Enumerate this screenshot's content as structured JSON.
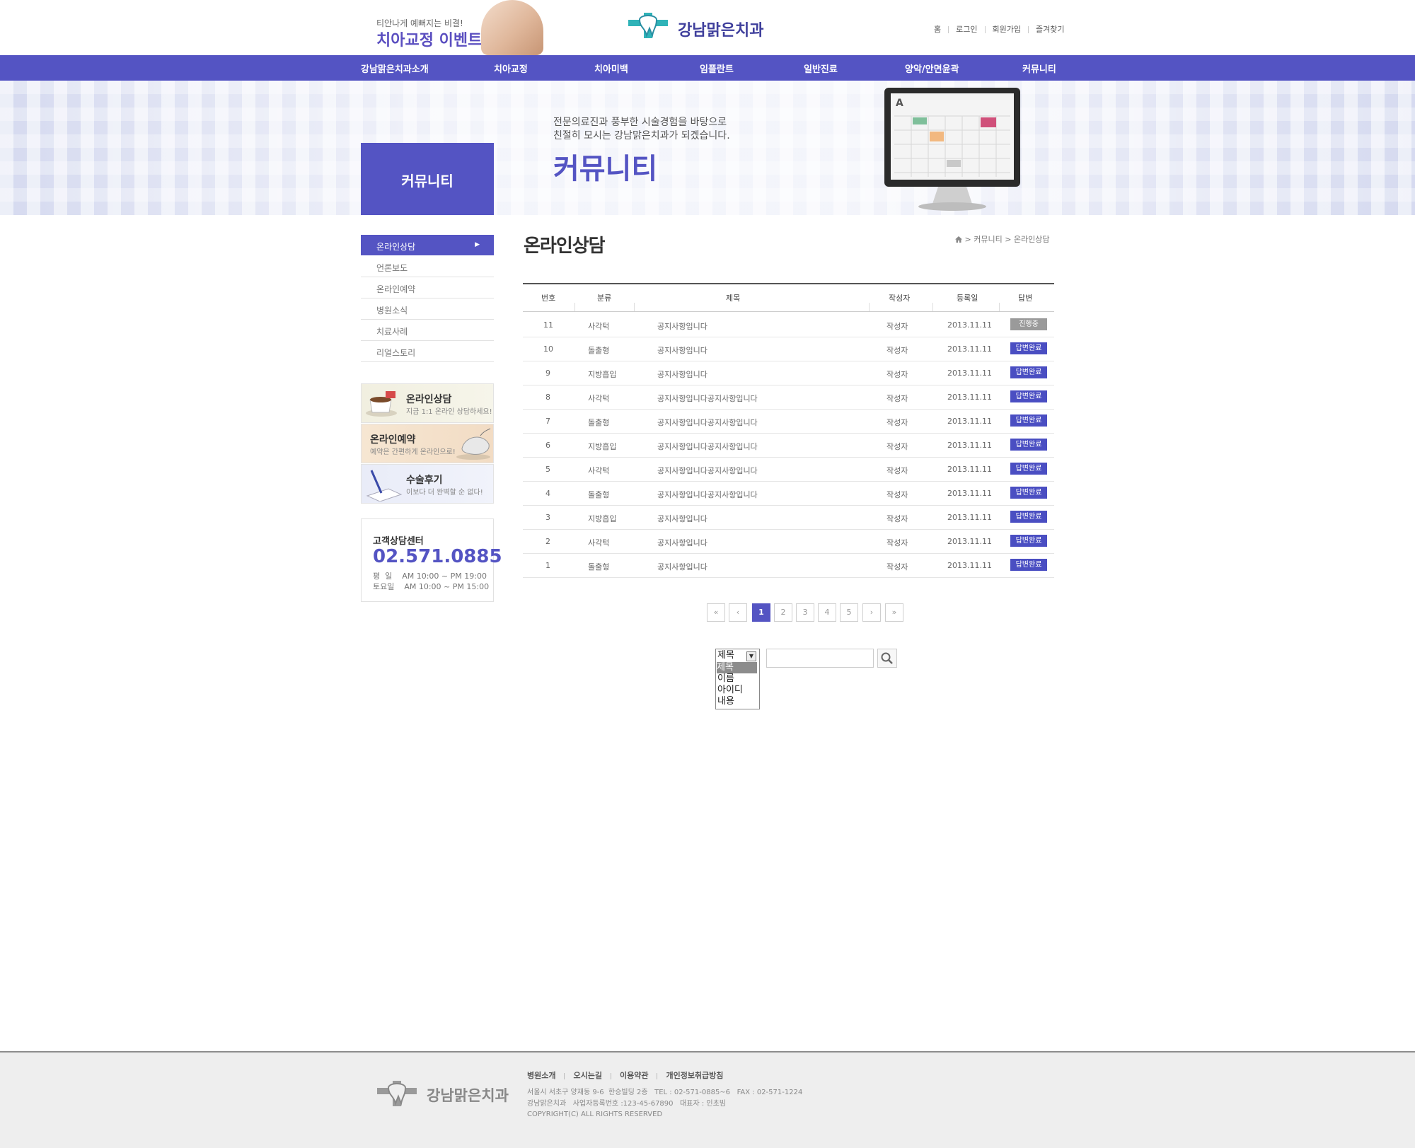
{
  "header": {
    "promo_sub": "티안나게 예뻐지는 비결!",
    "promo_title": "치아교정 이벤트",
    "logo_text": "강남맑은치과",
    "util_links": [
      "홈",
      "로그인",
      "회원가입",
      "즐겨찾기"
    ]
  },
  "gnb": [
    "강남맑은치과소개",
    "치아교정",
    "치아미백",
    "임플란트",
    "일반진료",
    "양악/안면윤곽",
    "커뮤니티"
  ],
  "banner": {
    "box_label": "커뮤니티",
    "line1": "전문의료진과 풍부한 시술경험을 바탕으로",
    "line2": "친절히 모시는 강남맑은치과가 되겠습니다.",
    "title": "커뮤니티"
  },
  "lnb": [
    "온라인상담",
    "언론보도",
    "온라인예약",
    "병원소식",
    "치료사례",
    "리얼스토리"
  ],
  "quick": [
    {
      "title": "온라인상담",
      "sub": "지금 1:1 온라인 상담하세요!"
    },
    {
      "title": "온라인예약",
      "sub": "예약은 간편하게 온라인으로!"
    },
    {
      "title": "수술후기",
      "sub": "이보다 더 완벽할 순 없다!"
    }
  ],
  "cs": {
    "title": "고객상담센터",
    "phone": "02.571.0885",
    "hours1": "평  일    AM 10:00 ~ PM 19:00",
    "hours2": "토요일    AM 10:00 ~ PM 15:00"
  },
  "content": {
    "page_title": "온라인상담",
    "breadcrumb": "> 커뮤니티 > 온라인상담"
  },
  "table": {
    "headers": [
      "번호",
      "분류",
      "제목",
      "작성자",
      "등록일",
      "답변"
    ],
    "rows": [
      {
        "no": "11",
        "cat": "사각턱",
        "title": "공지사항입니다",
        "writer": "작성자",
        "date": "2013.11.11",
        "status": "진행중",
        "state": "progress"
      },
      {
        "no": "10",
        "cat": "돌출형",
        "title": "공지사항입니다",
        "writer": "작성자",
        "date": "2013.11.11",
        "status": "답변완료",
        "state": "done"
      },
      {
        "no": "9",
        "cat": "지방흡입",
        "title": "공지사항입니다",
        "writer": "작성자",
        "date": "2013.11.11",
        "status": "답변완료",
        "state": "done"
      },
      {
        "no": "8",
        "cat": "사각턱",
        "title": "공지사항입니다공지사항입니다",
        "writer": "작성자",
        "date": "2013.11.11",
        "status": "답변완료",
        "state": "done"
      },
      {
        "no": "7",
        "cat": "돌출형",
        "title": "공지사항입니다공지사항입니다",
        "writer": "작성자",
        "date": "2013.11.11",
        "status": "답변완료",
        "state": "done"
      },
      {
        "no": "6",
        "cat": "지방흡입",
        "title": "공지사항입니다공지사항입니다",
        "writer": "작성자",
        "date": "2013.11.11",
        "status": "답변완료",
        "state": "done"
      },
      {
        "no": "5",
        "cat": "사각턱",
        "title": "공지사항입니다공지사항입니다",
        "writer": "작성자",
        "date": "2013.11.11",
        "status": "답변완료",
        "state": "done"
      },
      {
        "no": "4",
        "cat": "돌출형",
        "title": "공지사항입니다공지사항입니다",
        "writer": "작성자",
        "date": "2013.11.11",
        "status": "답변완료",
        "state": "done"
      },
      {
        "no": "3",
        "cat": "지방흡입",
        "title": "공지사항입니다",
        "writer": "작성자",
        "date": "2013.11.11",
        "status": "답변완료",
        "state": "done"
      },
      {
        "no": "2",
        "cat": "사각턱",
        "title": "공지사항입니다",
        "writer": "작성자",
        "date": "2013.11.11",
        "status": "답변완료",
        "state": "done"
      },
      {
        "no": "1",
        "cat": "돌출형",
        "title": "공지사항입니다",
        "writer": "작성자",
        "date": "2013.11.11",
        "status": "답변완료",
        "state": "done"
      }
    ]
  },
  "pagination": {
    "first": "«",
    "prev": "‹",
    "next": "›",
    "last": "»",
    "pages": [
      "1",
      "2",
      "3",
      "4",
      "5"
    ],
    "current": "1"
  },
  "search": {
    "selected": "제목",
    "options": [
      "제목",
      "이름",
      "아이디",
      "내용"
    ],
    "query": ""
  },
  "footer": {
    "logo_text": "강남맑은치과",
    "links": [
      "병원소개",
      "오시는길",
      "이용약관",
      "개인정보취급방침"
    ],
    "addr1": "서울시 서초구 양재동 9-6  한승빌딩 2층   TEL : 02-571-0885~6   FAX : 02-571-1224",
    "addr2": "강남맑은치과   사업자등록번호 :123-45-67890   대표자 : 인초빔",
    "copyright": "COPYRIGHT(C) ALL RIGHTS RESERVED"
  },
  "colors": {
    "brand": "#5454c3",
    "badge_done": "#4a4ec2",
    "badge_progress": "#9a9a9a",
    "logo_mark": "#2fb3b8"
  }
}
